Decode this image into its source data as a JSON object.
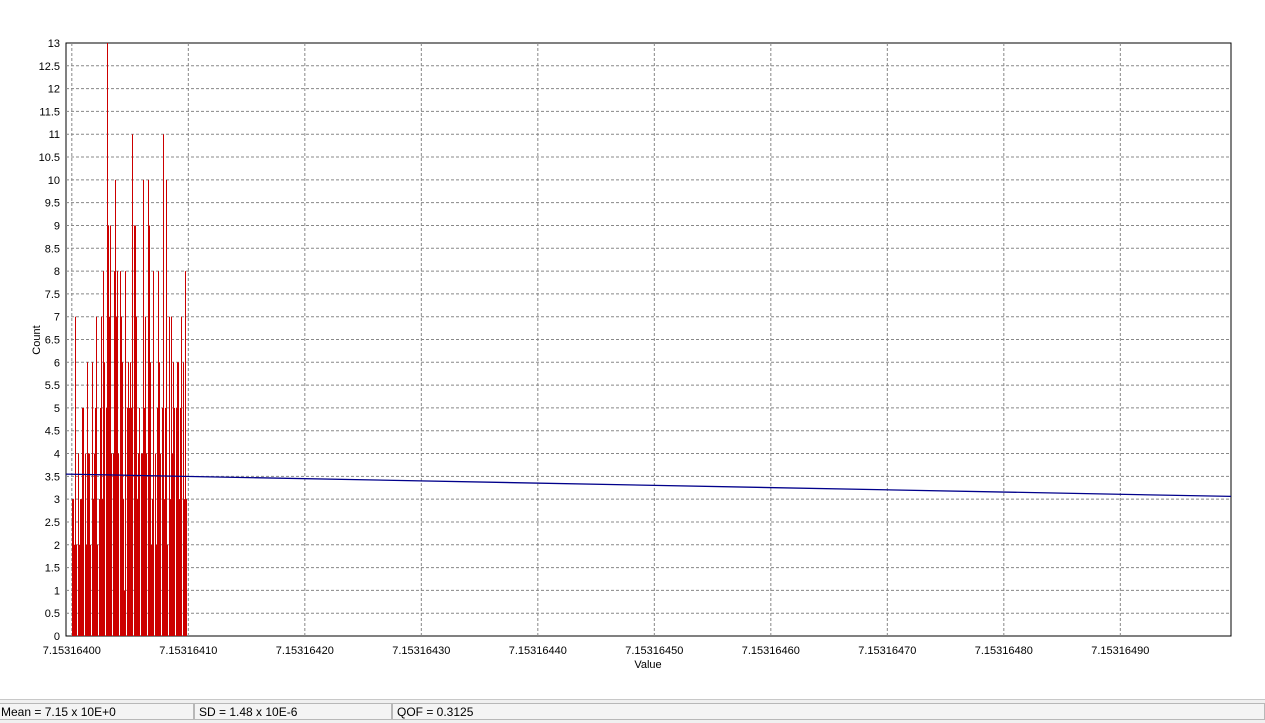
{
  "chart_data": {
    "type": "bar",
    "xlabel": "Value",
    "ylabel": "Count",
    "ylim": [
      0,
      13
    ],
    "xlim": [
      7.153163995,
      7.153164995
    ],
    "y_ticks": [
      "0",
      "0.5",
      "1",
      "1.5",
      "2",
      "2.5",
      "3",
      "3.5",
      "4",
      "4.5",
      "5",
      "5.5",
      "6",
      "6.5",
      "7",
      "7.5",
      "8",
      "8.5",
      "9",
      "9.5",
      "10",
      "10.5",
      "11",
      "11.5",
      "12",
      "12.5",
      "13"
    ],
    "x_ticks": [
      {
        "value": 7.153164,
        "label": "7.15316400"
      },
      {
        "value": 7.1531641,
        "label": "7.15316410"
      },
      {
        "value": 7.1531642,
        "label": "7.15316420"
      },
      {
        "value": 7.1531643,
        "label": "7.15316430"
      },
      {
        "value": 7.1531644,
        "label": "7.15316440"
      },
      {
        "value": 7.1531645,
        "label": "7.15316450"
      },
      {
        "value": 7.1531646,
        "label": "7.15316460"
      },
      {
        "value": 7.1531647,
        "label": "7.15316470"
      },
      {
        "value": 7.1531648,
        "label": "7.15316480"
      },
      {
        "value": 7.1531649,
        "label": "7.15316490"
      }
    ],
    "grid": true,
    "series": [
      {
        "color": "#cc0000",
        "x_start": 7.153164,
        "x_step": 1e-09,
        "values": [
          3,
          3,
          2,
          7,
          2,
          4,
          2,
          3,
          3,
          5,
          5,
          4,
          2,
          6,
          4,
          4,
          2,
          6,
          3,
          4,
          5,
          7,
          2,
          3,
          5,
          7,
          3,
          8,
          6,
          5,
          13,
          9,
          7,
          9,
          4,
          4,
          8,
          10,
          7,
          8,
          4,
          8,
          7,
          6,
          3,
          1,
          8,
          5,
          6,
          5,
          6,
          5,
          11,
          9,
          9,
          7,
          3,
          4,
          5,
          4,
          4,
          10,
          5,
          7,
          4,
          10,
          9,
          6,
          2,
          3,
          8,
          4,
          2,
          5,
          8,
          6,
          4,
          5,
          11,
          3,
          5,
          10,
          2,
          7,
          3,
          7,
          4,
          6,
          5,
          5,
          6,
          6,
          3,
          5,
          7,
          6,
          3,
          8,
          3
        ]
      },
      {
        "type": "line",
        "color": "#00008b",
        "x": [
          7.153163995,
          7.153164995
        ],
        "y": [
          3.55,
          3.06
        ]
      }
    ]
  },
  "status": {
    "mean": "Mean = 7.15 x 10E+0",
    "sd": "SD = 1.48 x 10E-6",
    "qof": "QOF = 0.3125"
  }
}
